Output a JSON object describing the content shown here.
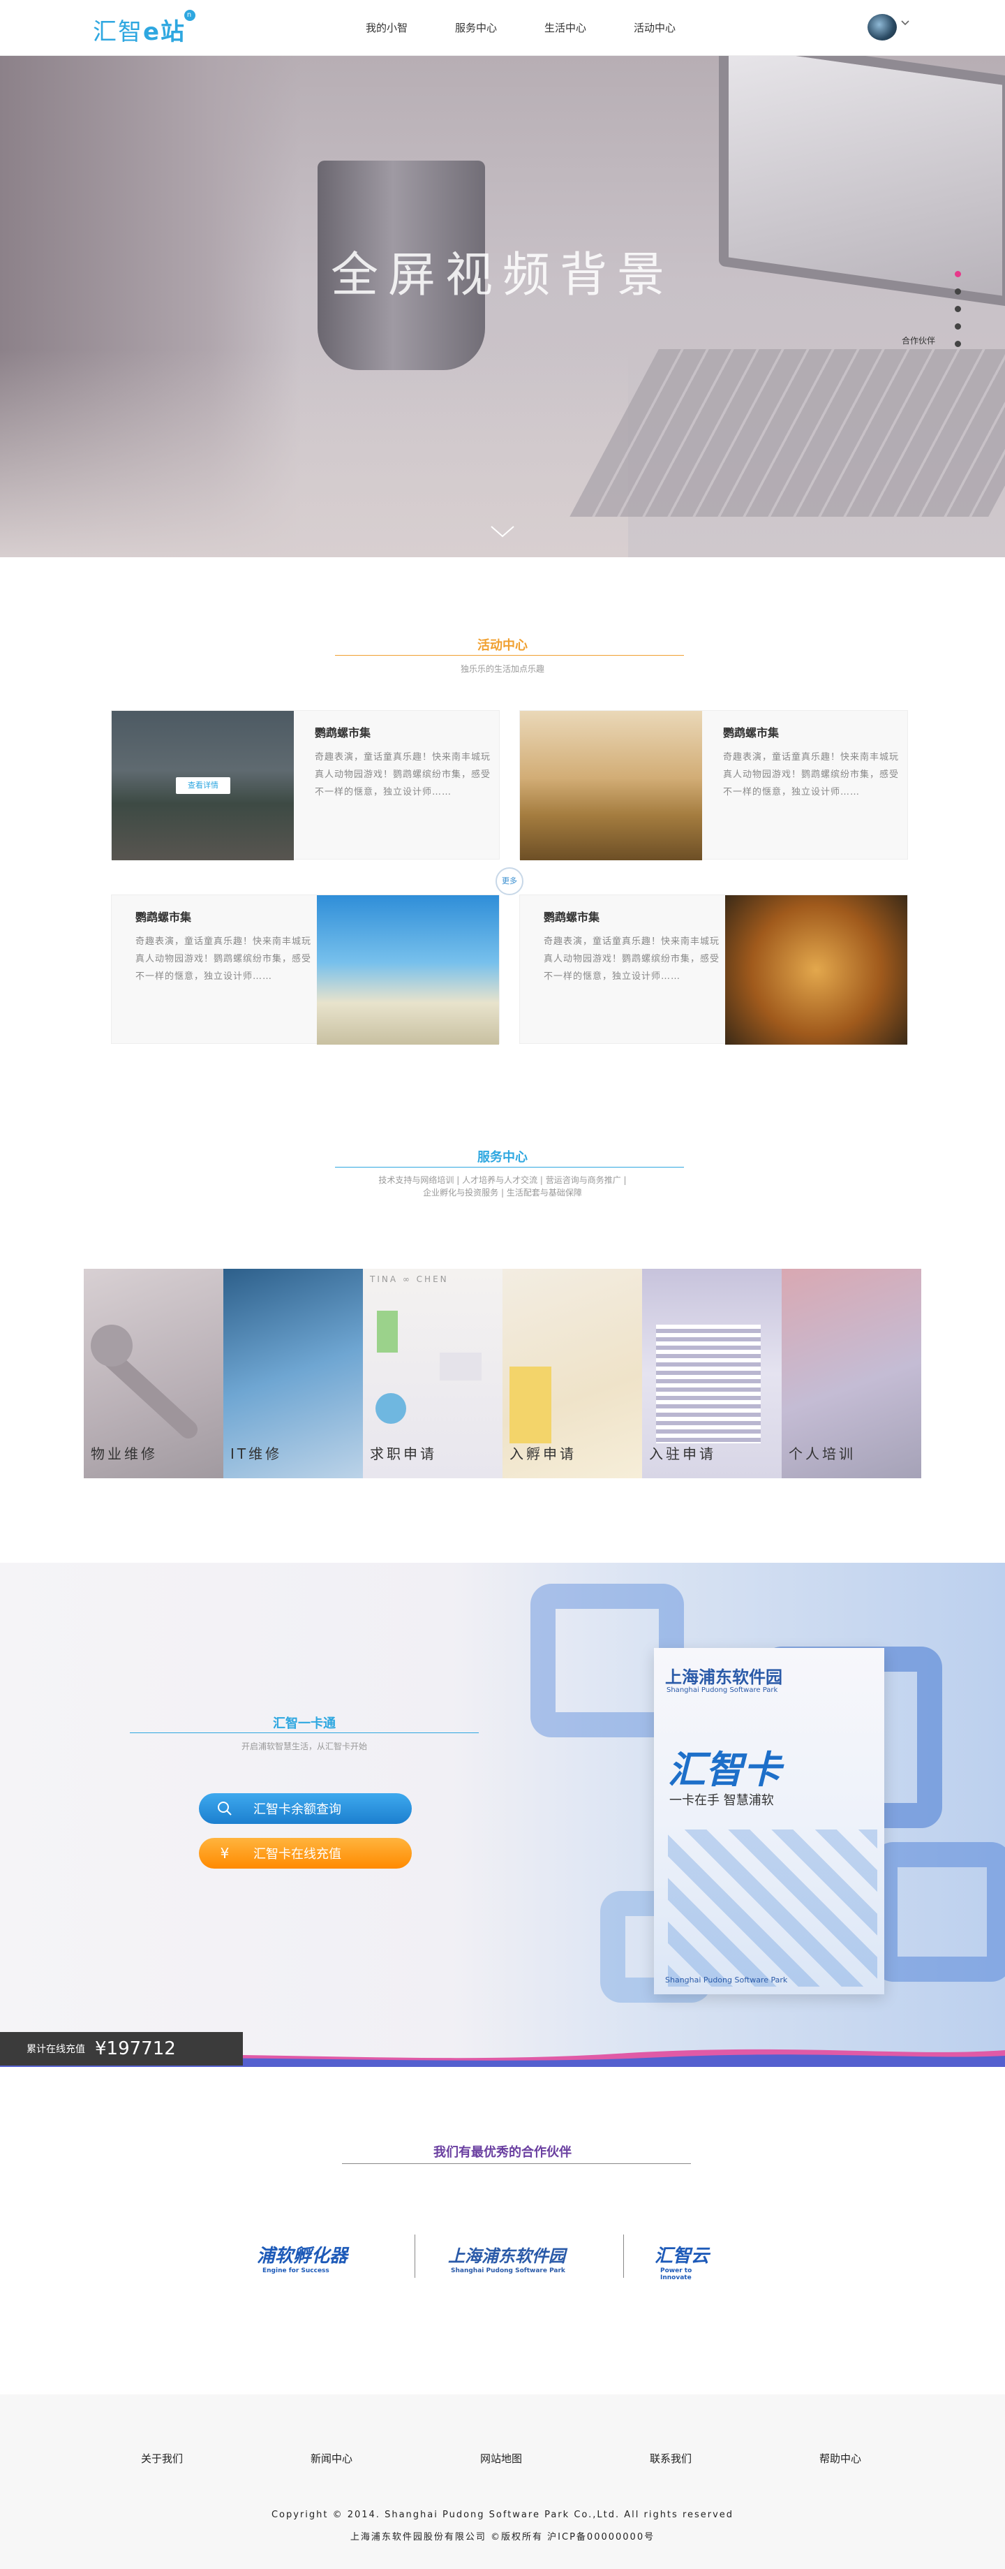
{
  "header": {
    "logo_text": "汇智",
    "logo_e": "e站",
    "logo_badge": "n",
    "nav": [
      "我的小智",
      "服务中心",
      "生活中心",
      "活动中心"
    ]
  },
  "hero": {
    "title": "全屏视频背景",
    "dot_label": "合作伙伴"
  },
  "activity": {
    "title": "活动中心",
    "subtitle": "独乐乐的生活加点乐趣",
    "more": "更多",
    "detail_btn": "查看详情",
    "cards": [
      {
        "name": "鹦鹉螺市集",
        "desc": "奇趣表演，童话童真乐趣！快来南丰城玩真人动物园游戏！鹦鹉螺缤纷市集，感受不一样的惬意，独立设计师……"
      },
      {
        "name": "鹦鹉螺市集",
        "desc": "奇趣表演，童话童真乐趣！快来南丰城玩真人动物园游戏！鹦鹉螺缤纷市集，感受不一样的惬意，独立设计师……"
      },
      {
        "name": "鹦鹉螺市集",
        "desc": "奇趣表演，童话童真乐趣！快来南丰城玩真人动物园游戏！鹦鹉螺缤纷市集，感受不一样的惬意，独立设计师……"
      },
      {
        "name": "鹦鹉螺市集",
        "desc": "奇趣表演，童话童真乐趣！快来南丰城玩真人动物园游戏！鹦鹉螺缤纷市集，感受不一样的惬意，独立设计师……"
      }
    ]
  },
  "service": {
    "title": "服务中心",
    "subtitle_line1": "技术支持与网络培训 | 人才培养与人才交流 | 营运咨询与商务推广 |",
    "subtitle_line2": "企业孵化与投资服务 | 生活配套与基础保障",
    "items": [
      "物业维修",
      "IT维修",
      "求职申请",
      "入孵申请",
      "入驻申请",
      "个人培训"
    ],
    "svc3_brand": "TINA ∞ CHEN"
  },
  "card": {
    "title": "汇智一卡通",
    "subtitle": "开启浦软智慧生活，从汇智卡开始",
    "btn_query": "汇智卡余额查询",
    "btn_recharge": "汇智卡在线充值",
    "btn_query_icon": "search-icon",
    "btn_recharge_icon": "yuan-icon",
    "yuan_glyph": "¥",
    "total_label": "累计在线充值",
    "total_value": "¥197712",
    "card_brand": "上海浦东软件园",
    "card_brand_en": "Shanghai Pudong Software Park",
    "card_name": "汇智卡",
    "card_slogan": "一卡在手  智慧浦软"
  },
  "partners": {
    "title": "我们有最优秀的合作伙伴",
    "logos": [
      {
        "name": "浦软孵化器",
        "tag": "Engine for Success"
      },
      {
        "name": "上海浦东软件园",
        "tag": "Shanghai Pudong Software Park"
      },
      {
        "name": "汇智云",
        "tag": "Power to Innovate"
      }
    ]
  },
  "footer": {
    "links": [
      "关于我们",
      "新闻中心",
      "网站地图",
      "联系我们",
      "帮助中心"
    ],
    "copyright": "Copyright © 2014. Shanghai Pudong Software Park Co.,Ltd. All rights reserved",
    "icp": "上海浦东软件园股份有限公司 ©版权所有 沪ICP备00000000号"
  },
  "colors": {
    "accent": "#2ea7e0",
    "activity_title": "#f0a030",
    "service_title": "#2ea7e0",
    "partner_title": "#6a3fa0",
    "pink": "#e6398a",
    "orange": "#ff8a00"
  }
}
